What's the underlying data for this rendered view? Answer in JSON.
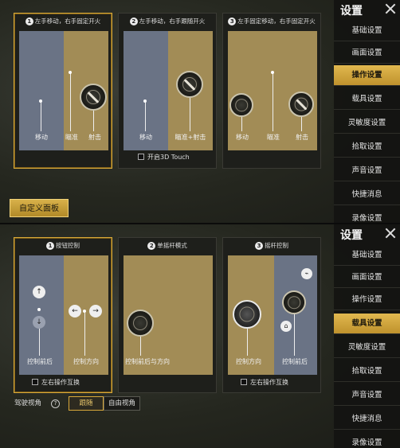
{
  "screen1": {
    "cards": [
      {
        "number": "1",
        "title": "左手移动，右手固定开火",
        "labels": [
          "移动",
          "瞄准",
          "射击"
        ]
      },
      {
        "number": "2",
        "title": "左手移动，右手跟随开火",
        "labels": [
          "移动",
          "瞄准+射击"
        ]
      },
      {
        "number": "3",
        "title": "左手固定移动，右手固定开火",
        "labels": [
          "移动",
          "瞄准",
          "射击"
        ]
      }
    ],
    "touch3d_label": "开启3D Touch",
    "custom_panel_label": "自定义面板",
    "menu": {
      "title": "设置",
      "items": [
        "基础设置",
        "画面设置",
        "操作设置",
        "载具设置",
        "灵敏度设置",
        "拾取设置",
        "声音设置",
        "快捷消息",
        "录像设置"
      ],
      "active_index": 2
    }
  },
  "screen2": {
    "cards": [
      {
        "number": "1",
        "title": "按钮控制",
        "labels": [
          "控制前后",
          "控制方向"
        ],
        "swap_label": "左右操作互换"
      },
      {
        "number": "2",
        "title": "单摇杆模式",
        "labels": [
          "控制前后与方向"
        ]
      },
      {
        "number": "3",
        "title": "摇杆控制",
        "labels": [
          "控制方向",
          "控制前后"
        ],
        "swap_label": "左右操作互换"
      }
    ],
    "driving_view_label": "驾驶视角",
    "help_symbol": "?",
    "view_options": [
      "跟随",
      "自由视角"
    ],
    "selected_view": "跟随",
    "menu": {
      "title": "设置",
      "items": [
        "基础设置",
        "画面设置",
        "操作设置",
        "载具设置",
        "灵敏度设置",
        "拾取设置",
        "声音设置",
        "快捷消息",
        "录像设置"
      ],
      "active_index": 3
    }
  },
  "colors": {
    "accent": "#d9a93a",
    "zone_blue": "#6a7385",
    "zone_gold": "#a28c56"
  }
}
